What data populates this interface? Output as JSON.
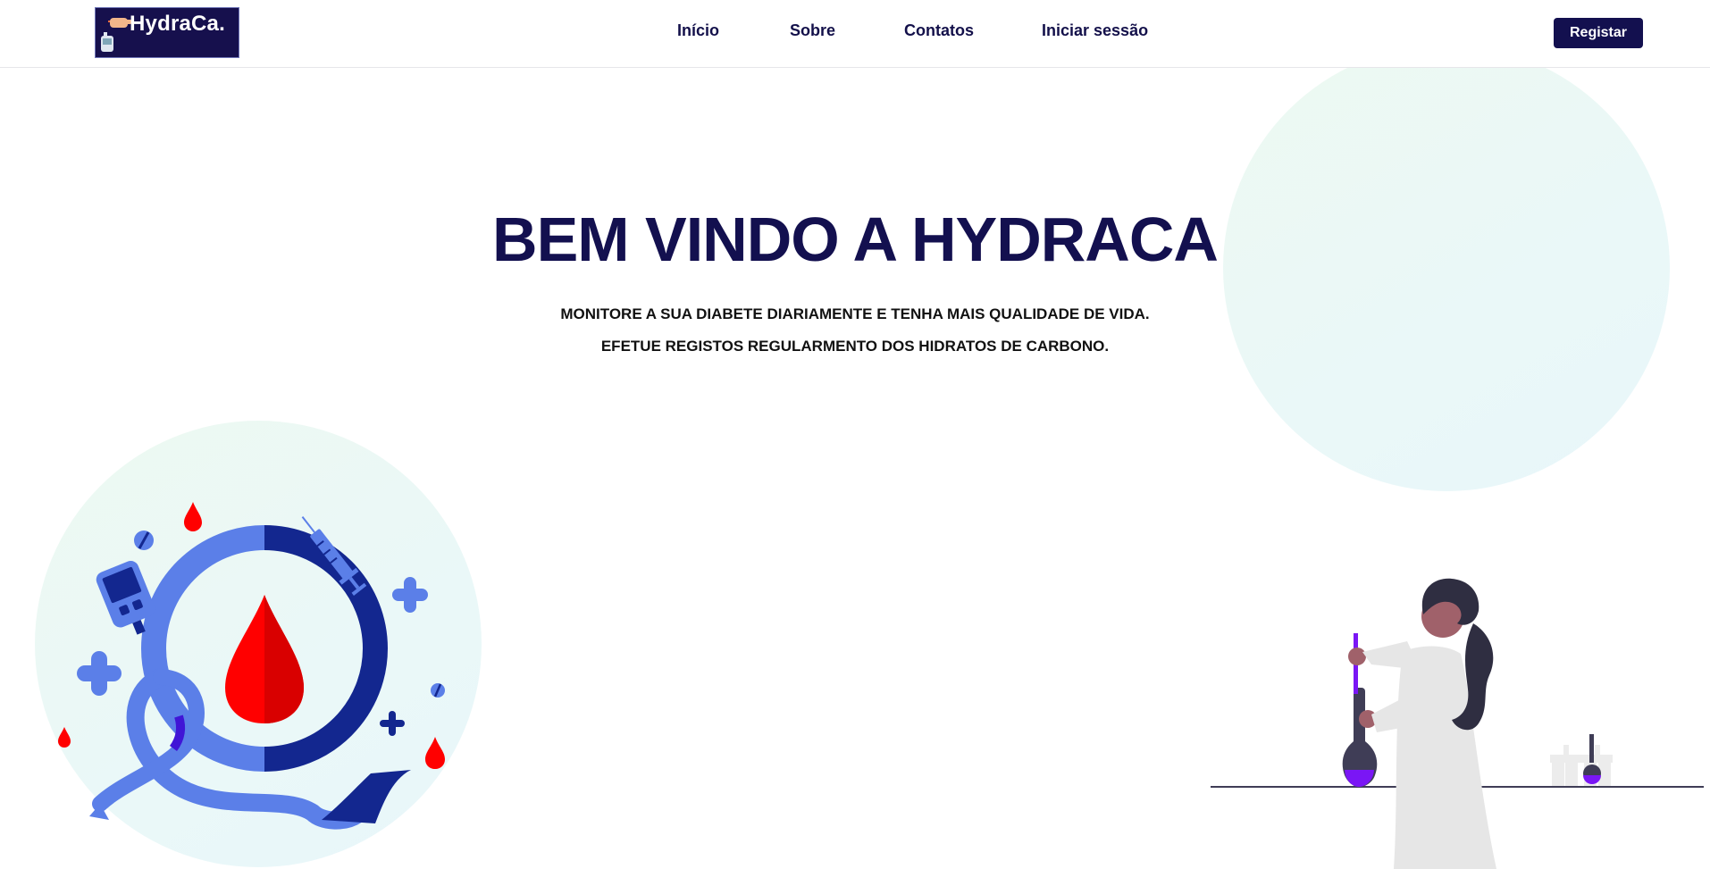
{
  "brand": {
    "name": "HydraCa."
  },
  "nav": {
    "items": [
      {
        "label": "Início"
      },
      {
        "label": "Sobre"
      },
      {
        "label": "Contatos"
      },
      {
        "label": "Iniciar sessão"
      }
    ],
    "register_label": "Registar"
  },
  "hero": {
    "title": "BEM VINDO A HYDRACA",
    "line1": "MONITORE A SUA DIABETE DIARIAMENTE E TENHA MAIS QUALIDADE DE VIDA.",
    "line2": "EFETUE REGISTOS REGULARMENTO DOS HIDRATOS DE CARBONO."
  },
  "colors": {
    "brand_navy": "#13104f",
    "blood_red": "#ff0000",
    "accent_blue": "#5b7fe8",
    "deep_blue": "#13278f",
    "accent_purple": "#7a16f5",
    "circle_mint": "#ebf8f3"
  },
  "icons": [
    "hand-pointer-icon",
    "glucose-meter-icon",
    "blood-drop-icon",
    "syringe-icon",
    "plus-icon",
    "pill-icon",
    "awareness-ribbon-icon"
  ]
}
